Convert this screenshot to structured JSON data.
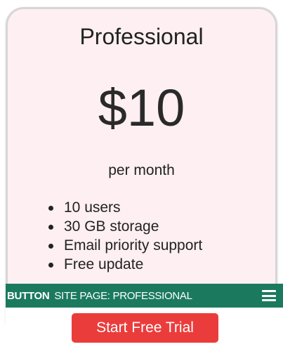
{
  "plan": {
    "title": "Professional",
    "price": "$10",
    "period": "per month",
    "features": [
      "10 users",
      "30 GB storage",
      "Email priority support",
      "Free update"
    ]
  },
  "overlay": {
    "tag": "BUTTON",
    "site_page": "SITE PAGE: PROFESSIONAL",
    "menu_icon": "hamburger-menu-icon"
  },
  "cta": {
    "label": "Start Free Trial"
  },
  "colors": {
    "card_background": "#fdeff2",
    "overlay_bar": "#1b7a5e",
    "cta_button": "#eb3c3c"
  }
}
